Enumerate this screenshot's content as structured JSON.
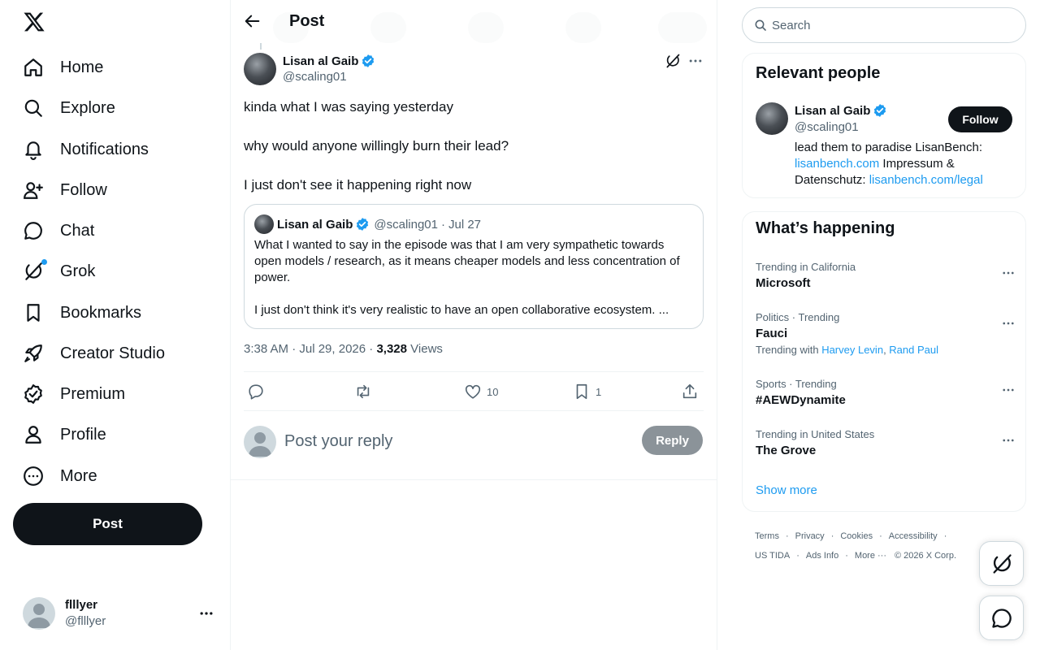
{
  "nav": {
    "items": [
      {
        "label": "Home",
        "icon": "home-icon"
      },
      {
        "label": "Explore",
        "icon": "search-icon"
      },
      {
        "label": "Notifications",
        "icon": "bell-icon"
      },
      {
        "label": "Follow",
        "icon": "add-person-icon"
      },
      {
        "label": "Chat",
        "icon": "chat-bubble-icon"
      },
      {
        "label": "Grok",
        "icon": "grok-icon"
      },
      {
        "label": "Bookmarks",
        "icon": "bookmark-icon"
      },
      {
        "label": "Creator Studio",
        "icon": "rocket-icon"
      },
      {
        "label": "Premium",
        "icon": "verified-badge-icon"
      },
      {
        "label": "Profile",
        "icon": "person-icon"
      },
      {
        "label": "More",
        "icon": "more-circle-icon"
      }
    ],
    "post_button": "Post"
  },
  "account": {
    "name": "flllyer",
    "handle": "@flllyer"
  },
  "header": {
    "title": "Post"
  },
  "post": {
    "author_name": "Lisan al Gaib",
    "author_handle": "@scaling01",
    "text": [
      "kinda what I was saying yesterday",
      "why would anyone willingly burn their lead?",
      "I just don't see it happening right now"
    ],
    "quote": {
      "author_name": "Lisan al Gaib",
      "author_handle": "@scaling01",
      "separator": "·",
      "date": "Jul 27",
      "text": [
        "What I wanted to say in the episode was that I am very sympathetic towards open models / research, as it means cheaper models and less concentration of power.",
        "I just don't think it's very realistic to have an open collaborative ecosystem. ..."
      ]
    },
    "timestamp": "3:38 AM · Jul 29, 2026 ·",
    "views_count": "3,328",
    "views_label": "Views",
    "likes": "10",
    "bookmarks": "1"
  },
  "reply": {
    "placeholder": "Post your reply",
    "button": "Reply"
  },
  "search": {
    "placeholder": "Search"
  },
  "relevant_people": {
    "title": "Relevant people",
    "person": {
      "name": "Lisan al Gaib",
      "handle": "@scaling01",
      "follow_label": "Follow",
      "bio_1": "lead them to paradise LisanBench: ",
      "bio_link_1": "lisanbench.com",
      "bio_2": " Impressum & Datenschutz: ",
      "bio_link_2": "lisanbench.com/legal"
    }
  },
  "trends": {
    "title": "What’s happening",
    "items": [
      {
        "context": "Trending in California",
        "name": "Microsoft"
      },
      {
        "context": "Politics · Trending",
        "name": "Fauci",
        "with_label": "Trending with",
        "with_links": [
          "Harvey Levin",
          "Rand Paul"
        ]
      },
      {
        "context": "Sports · Trending",
        "name": "#AEWDynamite"
      },
      {
        "context": "Trending in United States",
        "name": "The Grove"
      }
    ],
    "show_more": "Show more"
  },
  "footer": {
    "links": [
      "Terms",
      "Privacy",
      "Cookies",
      "Accessibility",
      "US TIDA",
      "Ads Info",
      "More ···"
    ],
    "dot": "·",
    "copyright": "© 2026 X Corp."
  },
  "colors": {
    "accent": "#1d9bf0",
    "text": "#0f1419",
    "secondary": "#536471",
    "border": "#eff3f4"
  }
}
